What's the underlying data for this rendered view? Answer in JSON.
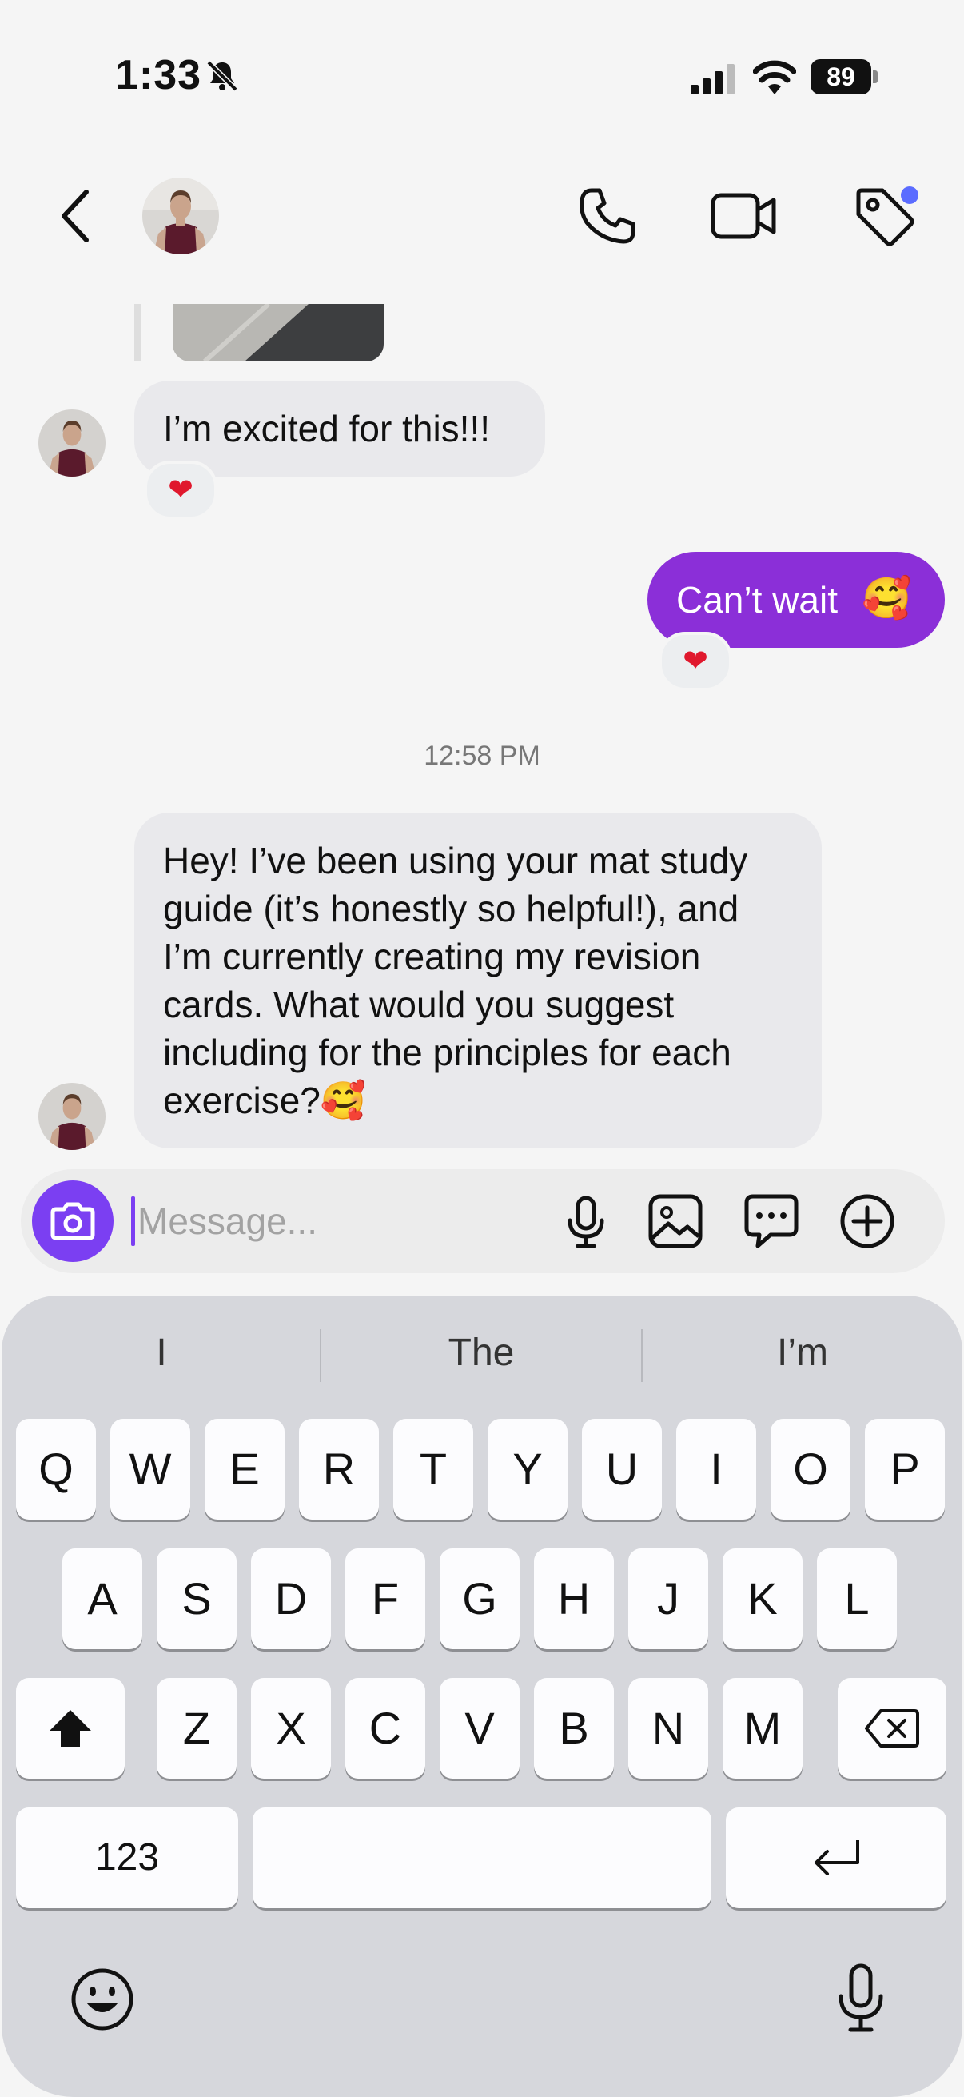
{
  "status_bar": {
    "time": "1:33",
    "battery": "89"
  },
  "header": {
    "back_icon": "chevron-left-icon",
    "call_icon": "phone-icon",
    "video_icon": "video-camera-icon",
    "tag_icon": "tag-icon"
  },
  "messages": {
    "incoming_1": "I’m excited for this!!!",
    "incoming_1_reaction": "❤",
    "outgoing_1": "Can’t wait",
    "outgoing_1_emoji": "🥰",
    "outgoing_1_reaction": "❤",
    "timestamp": "12:58 PM",
    "incoming_2_lines": [
      "Hey! I’ve been using your mat study",
      "guide (it’s honestly so helpful!), and",
      "I’m currently creating my revision",
      "cards. What would you suggest",
      "including for the principles for each",
      "exercise?"
    ],
    "incoming_2_emoji": "🥰"
  },
  "composer": {
    "placeholder": "Message..."
  },
  "keyboard": {
    "suggestions": [
      "I",
      "The",
      "I’m"
    ],
    "row1": [
      "Q",
      "W",
      "E",
      "R",
      "T",
      "Y",
      "U",
      "I",
      "O",
      "P"
    ],
    "row2": [
      "A",
      "S",
      "D",
      "F",
      "G",
      "H",
      "J",
      "K",
      "L"
    ],
    "row3": [
      "Z",
      "X",
      "C",
      "V",
      "B",
      "N",
      "M"
    ],
    "numbers_key": "123",
    "colors": {
      "accent": "#8b2fd8",
      "camera": "#7b3ff2",
      "badge": "#5b6cff"
    }
  }
}
